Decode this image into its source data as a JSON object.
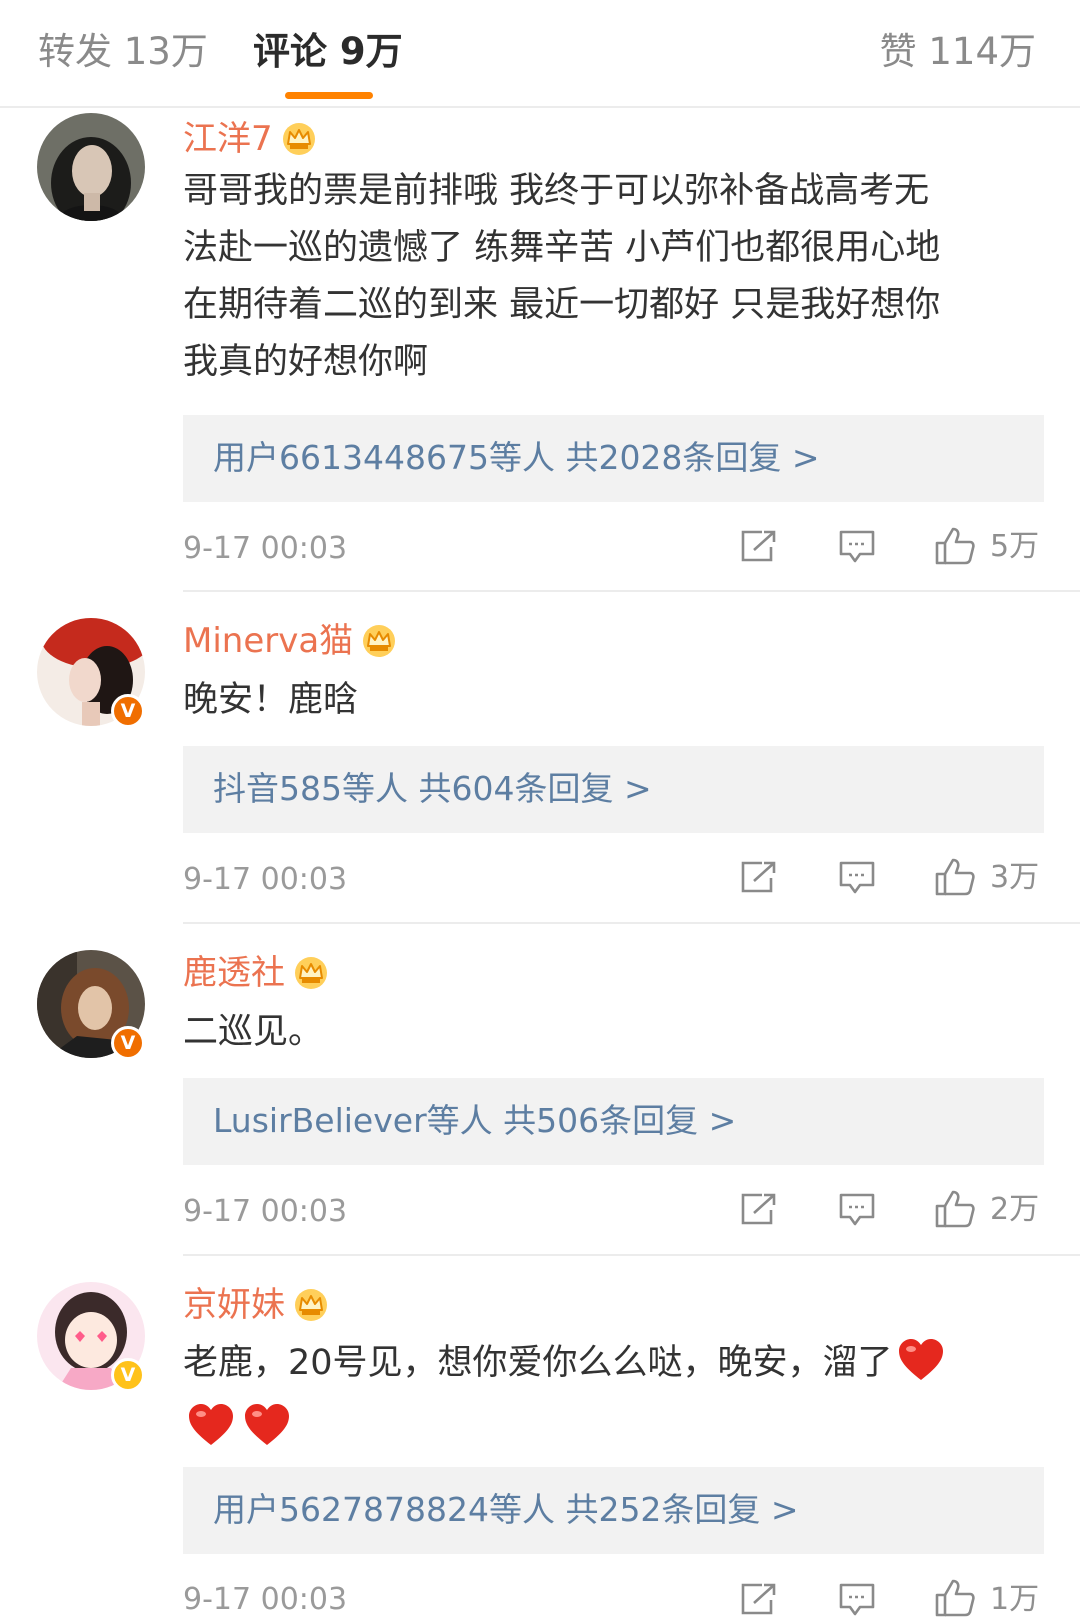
{
  "tabs": {
    "repost": "转发 13万",
    "comments": "评论 9万",
    "likes": "赞 114万"
  },
  "accent_color": "#ff8200",
  "comments": [
    {
      "user": "江洋7",
      "text": "哥哥我的票是前排哦 我终于可以弥补备战高考无法赴一巡的遗憾了 练舞辛苦 小芦们也都很用心地在期待着二巡的到来 最近一切都好 只是我好想你我真的好想你啊",
      "lines": [
        "哥哥我的票是前排哦 我终于可以弥补备战高考无",
        "法赴一巡的遗憾了 练舞辛苦 小芦们也都很用心地",
        "在期待着二巡的到来 最近一切都好 只是我好想你",
        "我真的好想你啊"
      ],
      "replies": "用户6613448675等人  共2028条回复 >",
      "time": "9-17 00:03",
      "likes": "5万"
    },
    {
      "user": "Minerva猫",
      "lines": [
        "晚安！鹿晗"
      ],
      "replies": "抖音585等人  共604条回复 >",
      "time": "9-17 00:03",
      "likes": "3万",
      "badge": "V"
    },
    {
      "user": "鹿透社",
      "lines": [
        "二巡见。"
      ],
      "replies": "LusirBeliever等人  共506条回复 >",
      "time": "9-17 00:03",
      "likes": "2万",
      "badge": "V"
    },
    {
      "user": "京妍妹",
      "lines": [
        "老鹿，20号见，想你爱你么么哒，晚安，溜了"
      ],
      "replies": "用户5627878824等人  共252条回复 >",
      "time": "9-17 00:03",
      "likes": "1万",
      "badge": "V"
    }
  ],
  "icons": [
    "crown-icon",
    "share-icon",
    "comment-icon",
    "thumbs-up-icon",
    "heart-emoji-icon",
    "verified-badge-icon"
  ]
}
